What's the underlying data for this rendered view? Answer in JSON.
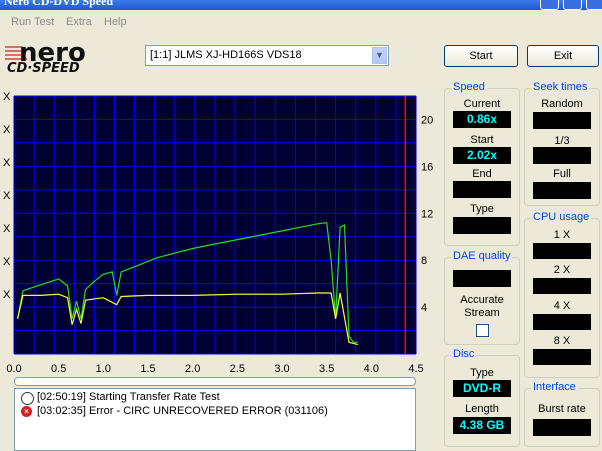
{
  "window": {
    "title": "Nero CD-DVD Speed"
  },
  "menu": [
    "Run Test",
    "Extra",
    "Help"
  ],
  "logo": {
    "line1": "nero",
    "line2": "CD·SPEED"
  },
  "drive": {
    "selected": "[1:1]  JLMS XJ-HD166S VDS18"
  },
  "buttons": {
    "start": "Start",
    "exit": "Exit"
  },
  "graph": {
    "left_axis_marks": [
      "X",
      "X",
      "X",
      "X",
      "X",
      "X",
      "X"
    ],
    "colors": {
      "background": "#000033",
      "grid": "#0000ff",
      "speed_line": "#22dd22",
      "rpm_line": "#ffff33",
      "marker": "#ff0000"
    }
  },
  "chart_data": {
    "type": "line",
    "x_ticks": [
      "0.0",
      "0.5",
      "1.0",
      "1.5",
      "2.0",
      "2.5",
      "3.0",
      "3.5",
      "4.0",
      "4.5"
    ],
    "y_right_ticks": [
      "20",
      "16",
      "12",
      "8",
      "4"
    ],
    "xlim": [
      0,
      4.5
    ],
    "ylim": [
      0,
      22
    ],
    "series": [
      {
        "values": [
          [
            0.04,
            3.0
          ],
          [
            0.1,
            5.4
          ],
          [
            0.3,
            5.9
          ],
          [
            0.5,
            6.4
          ],
          [
            0.6,
            5.8
          ],
          [
            0.65,
            3.0
          ],
          [
            0.7,
            4.5
          ],
          [
            0.75,
            3.0
          ],
          [
            0.8,
            5.5
          ],
          [
            0.9,
            6.2
          ],
          [
            1.0,
            6.8
          ],
          [
            1.1,
            7.0
          ],
          [
            1.15,
            5.0
          ],
          [
            1.2,
            7.0
          ],
          [
            1.4,
            7.6
          ],
          [
            1.6,
            8.2
          ],
          [
            1.8,
            8.6
          ],
          [
            2.0,
            9.0
          ],
          [
            2.2,
            9.3
          ],
          [
            2.4,
            9.6
          ],
          [
            2.6,
            9.9
          ],
          [
            2.8,
            10.2
          ],
          [
            3.0,
            10.5
          ],
          [
            3.2,
            10.8
          ],
          [
            3.4,
            11.1
          ],
          [
            3.5,
            11.2
          ],
          [
            3.55,
            8.0
          ],
          [
            3.6,
            3.0
          ],
          [
            3.65,
            10.8
          ],
          [
            3.7,
            11.0
          ],
          [
            3.75,
            1.5
          ],
          [
            3.8,
            1.0
          ],
          [
            3.85,
            1.0
          ]
        ]
      },
      {
        "values": [
          [
            0.04,
            3.0
          ],
          [
            0.1,
            5.0
          ],
          [
            0.3,
            5.0
          ],
          [
            0.5,
            5.1
          ],
          [
            0.6,
            4.8
          ],
          [
            0.65,
            2.5
          ],
          [
            0.7,
            3.8
          ],
          [
            0.75,
            2.6
          ],
          [
            0.8,
            4.6
          ],
          [
            1.0,
            4.8
          ],
          [
            1.15,
            4.2
          ],
          [
            1.2,
            4.9
          ],
          [
            1.5,
            5.0
          ],
          [
            2.0,
            5.0
          ],
          [
            2.5,
            5.1
          ],
          [
            3.0,
            5.1
          ],
          [
            3.4,
            5.2
          ],
          [
            3.55,
            5.2
          ],
          [
            3.6,
            3.0
          ],
          [
            3.65,
            5.2
          ],
          [
            3.75,
            1.0
          ],
          [
            3.85,
            0.8
          ]
        ]
      }
    ],
    "marker_x": 4.38,
    "grid": true
  },
  "speed": {
    "title": "Speed",
    "current_label": "Current",
    "current_value": "0.86x",
    "start_label": "Start",
    "start_value": "2.02x",
    "end_label": "End",
    "end_value": "",
    "type_label": "Type",
    "type_value": ""
  },
  "seek": {
    "title": "Seek times",
    "random": "Random",
    "third": "1/3",
    "full": "Full"
  },
  "cpu": {
    "title": "CPU usage",
    "x1": "1 X",
    "x2": "2 X",
    "x4": "4 X",
    "x8": "8 X"
  },
  "dae": {
    "title": "DAE quality",
    "accurate_label": "Accurate",
    "stream_label": "Stream"
  },
  "disc": {
    "title": "Disc",
    "type_label": "Type",
    "type_value": "DVD-R",
    "length_label": "Length",
    "length_value": "4.38 GB"
  },
  "iface": {
    "title": "Interface",
    "burst_label": "Burst rate"
  },
  "log": [
    {
      "time": "[02:50:19]",
      "msg": "Starting Transfer Rate Test"
    },
    {
      "time": "[03:02:35]",
      "msg": "Error - CIRC UNRECOVERED ERROR (031106)"
    }
  ]
}
